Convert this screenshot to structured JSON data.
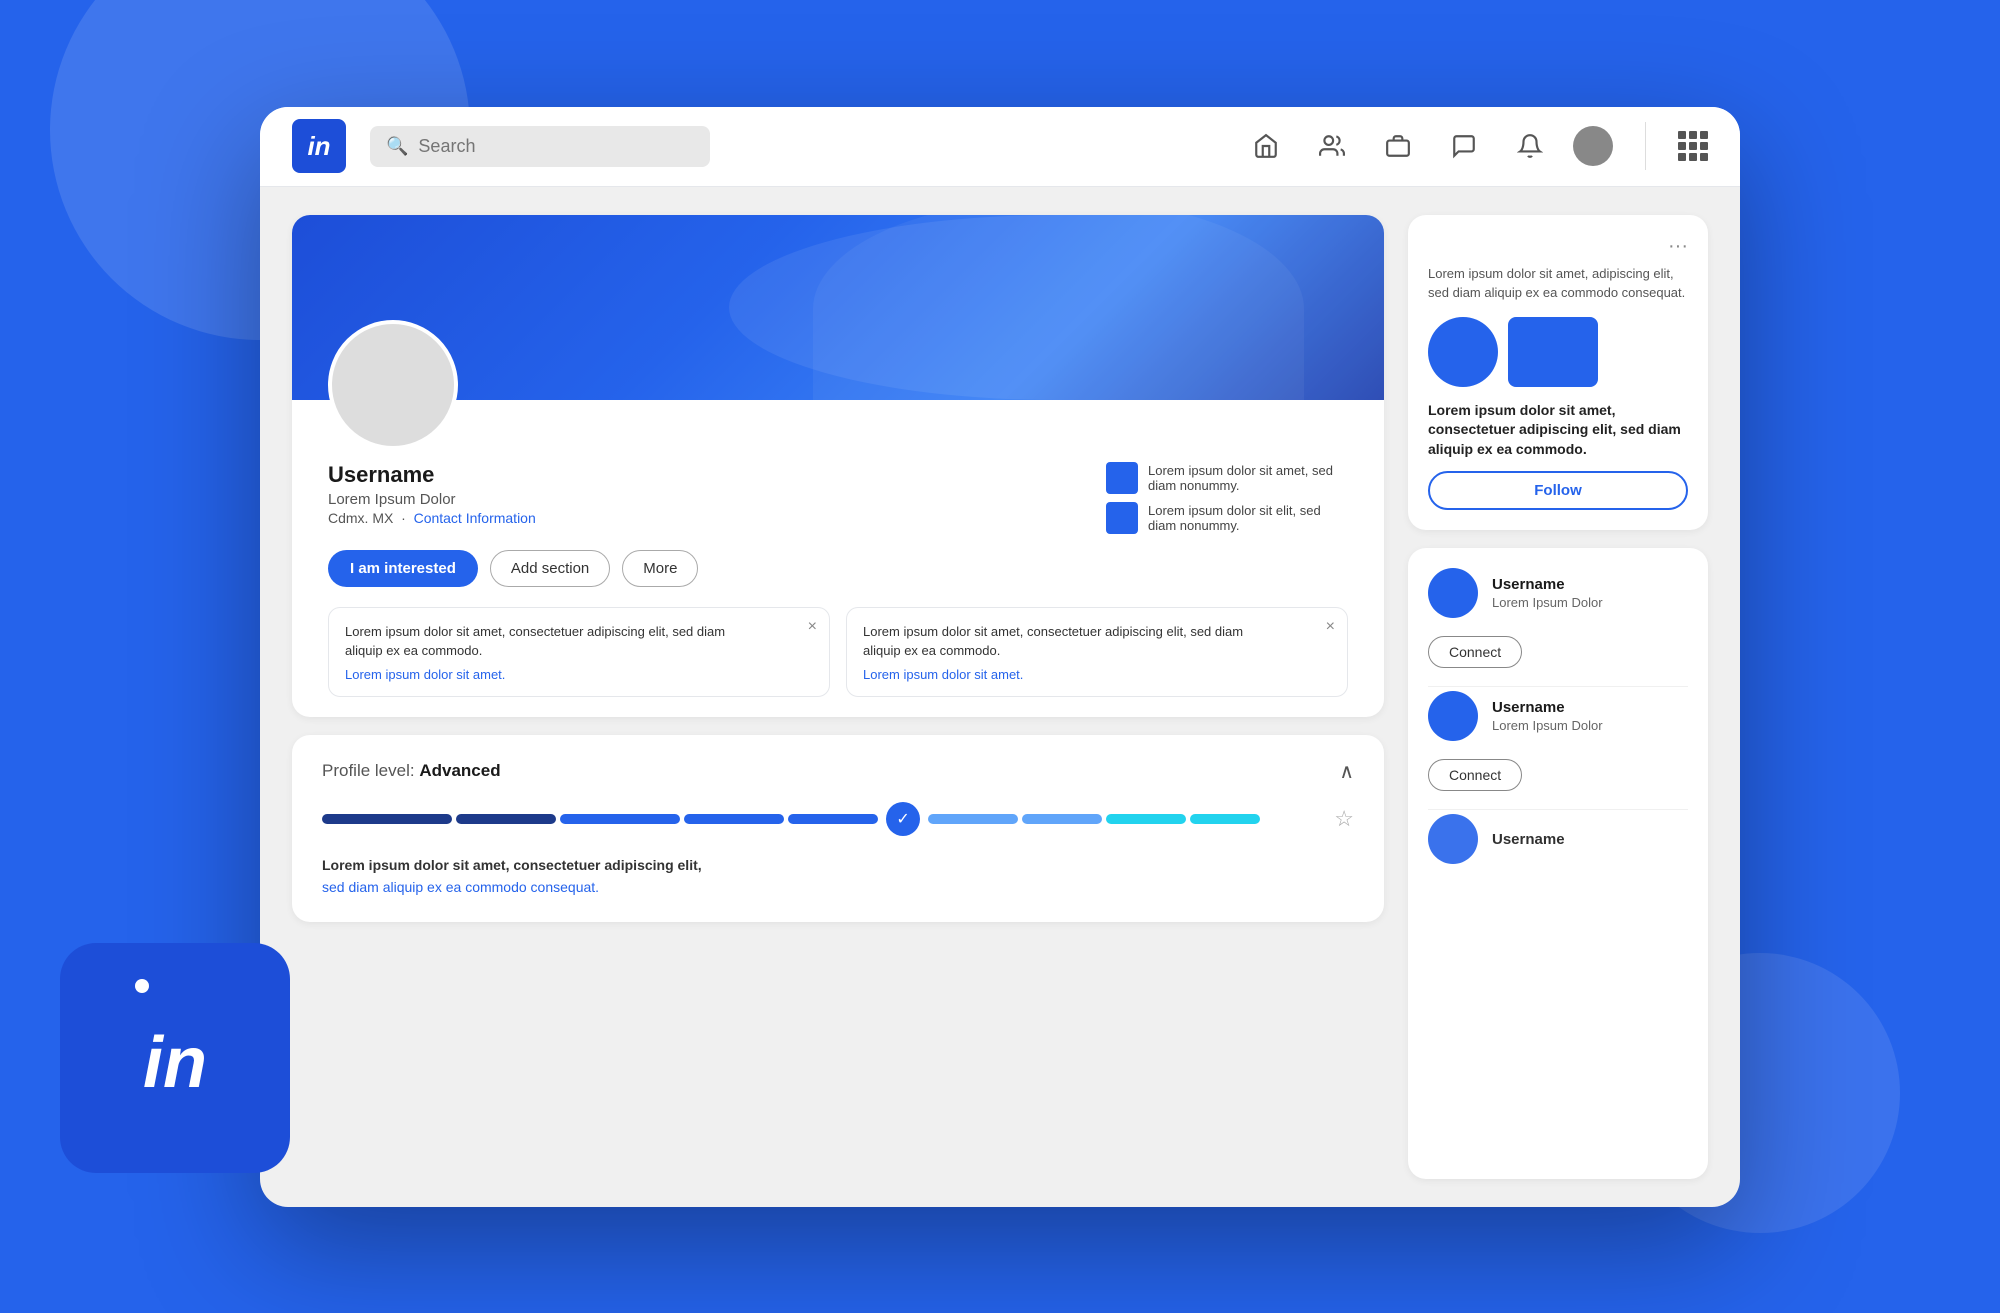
{
  "background": {
    "color": "#2563eb"
  },
  "navbar": {
    "logo_text": "in",
    "search_placeholder": "Search",
    "icons": [
      "home",
      "people",
      "briefcase",
      "chat",
      "bell"
    ],
    "grid_label": "grid"
  },
  "profile_card": {
    "username": "Username",
    "subtitle": "Lorem Ipsum Dolor",
    "location": "Cdmx. MX",
    "contact_label": "Contact Information",
    "meta_items": [
      {
        "text": "Lorem ipsum dolor sit amet, sed diam nonummy."
      },
      {
        "text": "Lorem ipsum dolor sit elit, sed diam nonummy."
      }
    ],
    "actions": [
      {
        "label": "I am interested",
        "type": "primary"
      },
      {
        "label": "Add section",
        "type": "outline"
      },
      {
        "label": "More",
        "type": "outline"
      }
    ]
  },
  "notifications": [
    {
      "title": "Lorem ipsum dolor sit amet, consectetuer adipiscing elit, sed diam aliquip ex ea commodo.",
      "link": "Lorem ipsum dolor sit amet."
    },
    {
      "title": "Lorem ipsum dolor sit amet, consectetuer adipiscing elit, sed diam aliquip ex ea commodo.",
      "link": "Lorem ipsum dolor sit amet."
    }
  ],
  "profile_level": {
    "title": "Profile level:",
    "level": "Advanced",
    "description_bold": "Lorem ipsum dolor sit amet, consectetuer adipiscing elit,",
    "description": "sed diam aliquip ex ea commodo consequat."
  },
  "ad_card": {
    "more_icon": "···",
    "description": "Lorem ipsum dolor sit amet, adipiscing elit, sed diam aliquip ex ea commodo consequat.",
    "title": "Lorem ipsum dolor sit amet, consectetuer adipiscing elit, sed diam aliquip ex ea commodo.",
    "follow_label": "Follow"
  },
  "people": [
    {
      "name": "Username",
      "subtitle": "Lorem Ipsum Dolor",
      "connect_label": "Connect"
    },
    {
      "name": "Username",
      "subtitle": "Lorem Ipsum Dolor",
      "connect_label": "Connect"
    },
    {
      "name": "Username",
      "subtitle": "",
      "connect_label": ""
    }
  ]
}
